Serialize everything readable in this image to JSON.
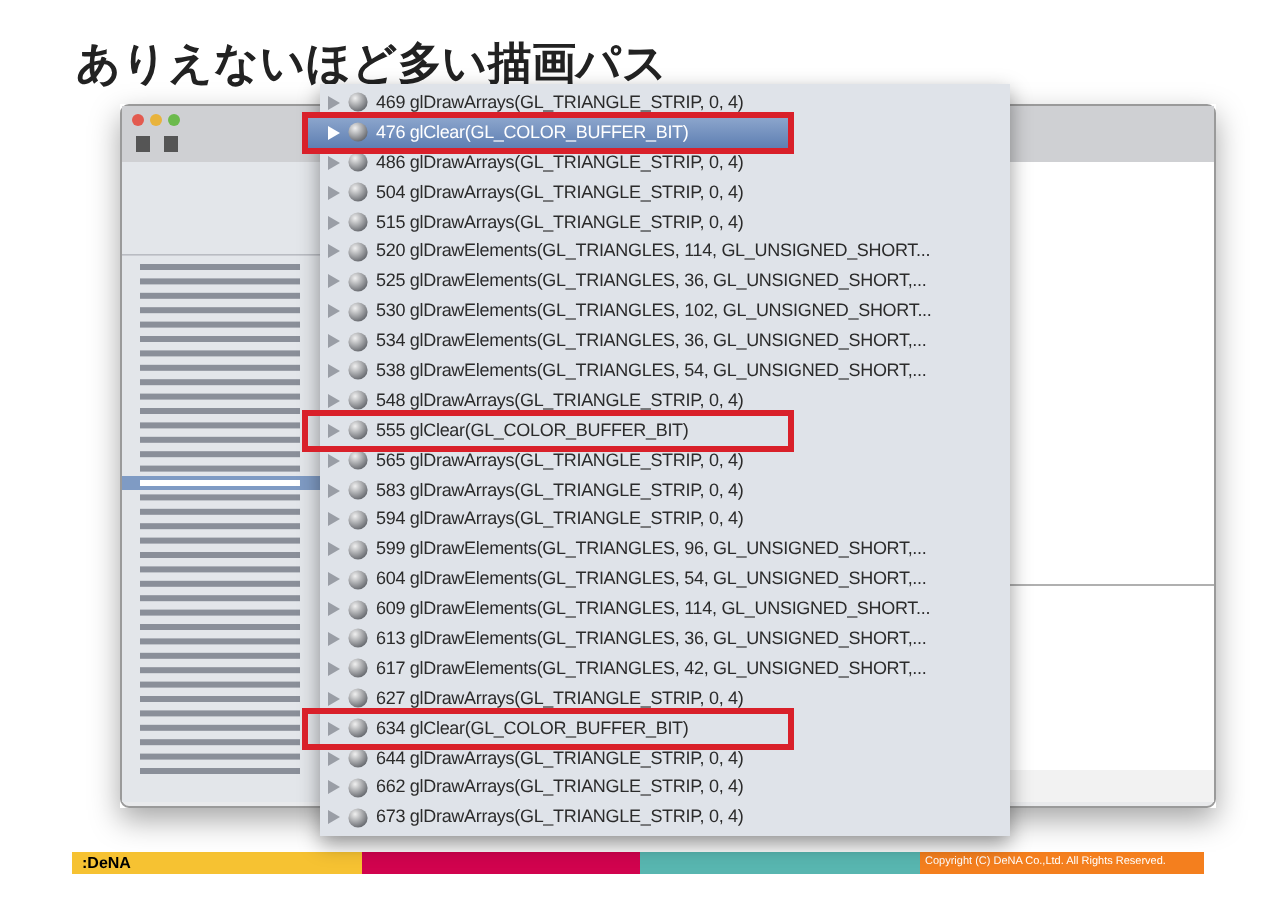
{
  "slide_title": "ありえないほど多い描画パス",
  "call_list": [
    {
      "text": "469 glDrawArrays(GL_TRIANGLE_STRIP, 0, 4)",
      "selected": false,
      "highlighted": false
    },
    {
      "text": "476 glClear(GL_COLOR_BUFFER_BIT)",
      "selected": true,
      "highlighted": true
    },
    {
      "text": "486 glDrawArrays(GL_TRIANGLE_STRIP, 0, 4)",
      "selected": false,
      "highlighted": false
    },
    {
      "text": "504 glDrawArrays(GL_TRIANGLE_STRIP, 0, 4)",
      "selected": false,
      "highlighted": false
    },
    {
      "text": "515 glDrawArrays(GL_TRIANGLE_STRIP, 0, 4)",
      "selected": false,
      "highlighted": false
    },
    {
      "text": "520 glDrawElements(GL_TRIANGLES, 114, GL_UNSIGNED_SHORT...",
      "selected": false,
      "highlighted": false
    },
    {
      "text": "525 glDrawElements(GL_TRIANGLES, 36, GL_UNSIGNED_SHORT,...",
      "selected": false,
      "highlighted": false
    },
    {
      "text": "530 glDrawElements(GL_TRIANGLES, 102, GL_UNSIGNED_SHORT...",
      "selected": false,
      "highlighted": false
    },
    {
      "text": "534 glDrawElements(GL_TRIANGLES, 36, GL_UNSIGNED_SHORT,...",
      "selected": false,
      "highlighted": false
    },
    {
      "text": "538 glDrawElements(GL_TRIANGLES, 54, GL_UNSIGNED_SHORT,...",
      "selected": false,
      "highlighted": false
    },
    {
      "text": "548 glDrawArrays(GL_TRIANGLE_STRIP, 0, 4)",
      "selected": false,
      "highlighted": false
    },
    {
      "text": "555 glClear(GL_COLOR_BUFFER_BIT)",
      "selected": false,
      "highlighted": true
    },
    {
      "text": "565 glDrawArrays(GL_TRIANGLE_STRIP, 0, 4)",
      "selected": false,
      "highlighted": false
    },
    {
      "text": "583 glDrawArrays(GL_TRIANGLE_STRIP, 0, 4)",
      "selected": false,
      "highlighted": false
    },
    {
      "text": "594 glDrawArrays(GL_TRIANGLE_STRIP, 0, 4)",
      "selected": false,
      "highlighted": false
    },
    {
      "text": "599 glDrawElements(GL_TRIANGLES, 96, GL_UNSIGNED_SHORT,...",
      "selected": false,
      "highlighted": false
    },
    {
      "text": "604 glDrawElements(GL_TRIANGLES, 54, GL_UNSIGNED_SHORT,...",
      "selected": false,
      "highlighted": false
    },
    {
      "text": "609 glDrawElements(GL_TRIANGLES, 114, GL_UNSIGNED_SHORT...",
      "selected": false,
      "highlighted": false
    },
    {
      "text": "613 glDrawElements(GL_TRIANGLES, 36, GL_UNSIGNED_SHORT,...",
      "selected": false,
      "highlighted": false
    },
    {
      "text": "617 glDrawElements(GL_TRIANGLES, 42, GL_UNSIGNED_SHORT,...",
      "selected": false,
      "highlighted": false
    },
    {
      "text": "627 glDrawArrays(GL_TRIANGLE_STRIP, 0, 4)",
      "selected": false,
      "highlighted": false
    },
    {
      "text": "634 glClear(GL_COLOR_BUFFER_BIT)",
      "selected": false,
      "highlighted": true
    },
    {
      "text": "644 glDrawArrays(GL_TRIANGLE_STRIP, 0, 4)",
      "selected": false,
      "highlighted": false
    },
    {
      "text": "662 glDrawArrays(GL_TRIANGLE_STRIP, 0, 4)",
      "selected": false,
      "highlighted": false
    },
    {
      "text": "673 glDrawArrays(GL_TRIANGLE_STRIP, 0, 4)",
      "selected": false,
      "highlighted": false
    }
  ],
  "footer": {
    "logo": ":DeNA",
    "copyright": "Copyright (C) DeNA Co.,Ltd. All Rights Reserved."
  }
}
